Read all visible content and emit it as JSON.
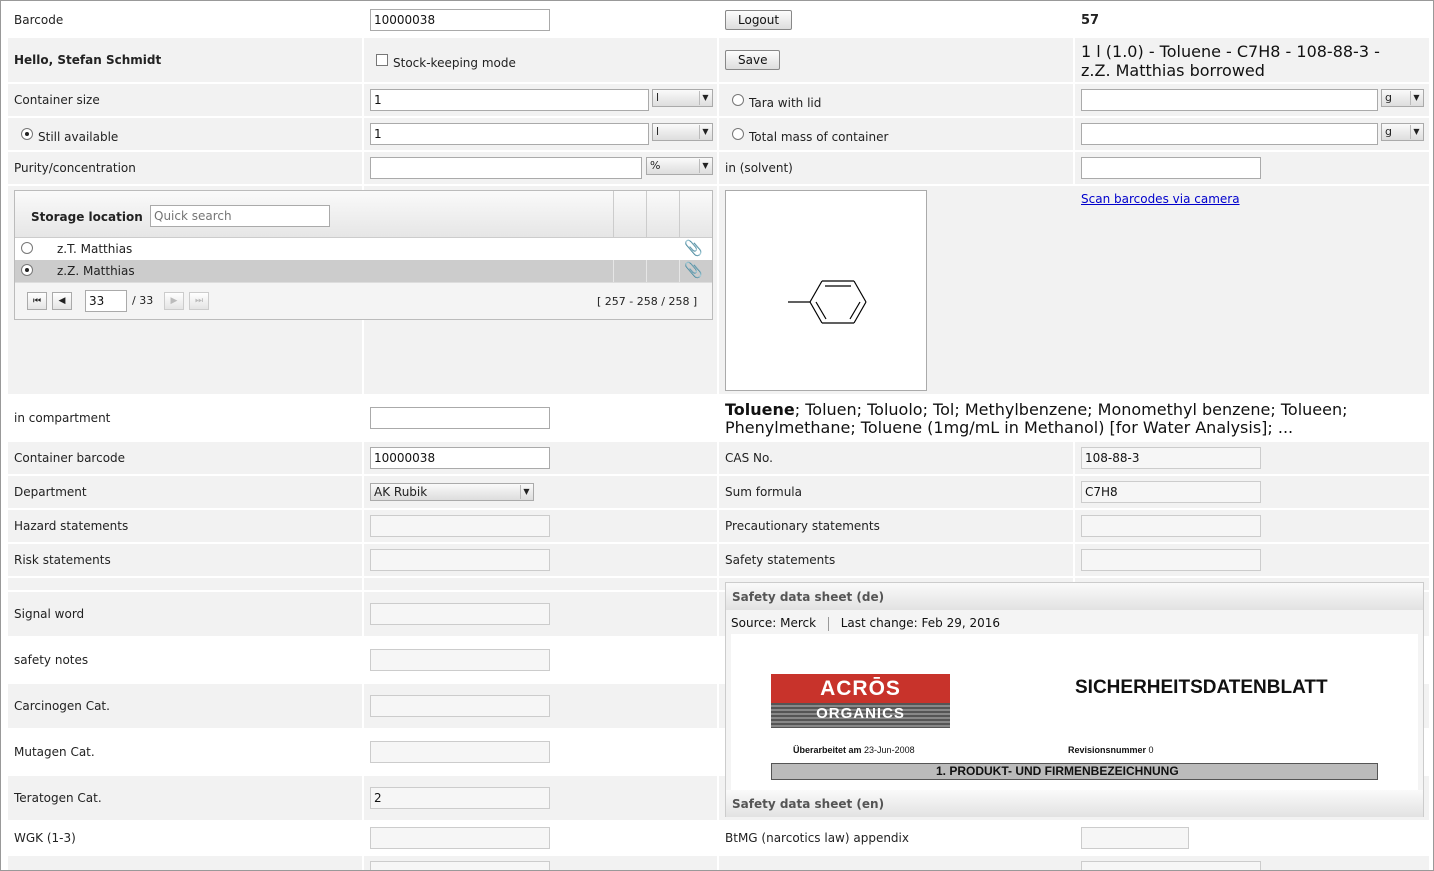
{
  "header": {
    "barcode_label": "Barcode",
    "barcode_value": "10000038",
    "logout_label": "Logout",
    "id_number": "57",
    "greeting": "Hello, Stefan Schmidt",
    "stock_mode_label": "Stock-keeping mode",
    "save_label": "Save",
    "summary_line1": "1 l (1.0) - Toluene - C7H8 - 108-88-3 -",
    "summary_line2": "z.Z. Matthias borrowed"
  },
  "amounts": {
    "container_size_label": "Container size",
    "container_size_value": "1",
    "container_size_unit": "l",
    "tara_label": "Tara with lid",
    "tara_value": "",
    "tara_unit": "g",
    "still_available_label": "Still available",
    "still_available_value": "1",
    "still_available_unit": "l",
    "total_mass_label": "Total mass of container",
    "total_mass_value": "",
    "total_mass_unit": "g",
    "purity_label": "Purity/concentration",
    "purity_value": "",
    "purity_unit": "%",
    "solvent_label": "in (solvent)",
    "solvent_value": ""
  },
  "storage": {
    "title": "Storage location",
    "search_placeholder": "Quick search",
    "rows": [
      {
        "name": "z.T. Matthias",
        "selected": false
      },
      {
        "name": "z.Z. Matthias",
        "selected": true
      }
    ],
    "page_value": "33",
    "page_total": "/ 33",
    "range": "[ 257 - 258 / 258 ]"
  },
  "scan_link": "Scan barcodes via camera",
  "compound": {
    "name_bold": "Toluene",
    "synonyms_line1": "; Toluen; Toluolo; Tol; Methylbenzene; Monomethyl benzene; Tolueen;",
    "synonyms_line2": "Phenylmethane; Toluene (1mg/mL in Methanol) [for Water Analysis]; ..."
  },
  "fields": {
    "compartment_label": "in compartment",
    "compartment_value": "",
    "container_barcode_label": "Container barcode",
    "container_barcode_value": "10000038",
    "cas_label": "CAS No.",
    "cas_value": "108-88-3",
    "department_label": "Department",
    "department_value": "AK Rubik",
    "sum_formula_label": "Sum formula",
    "sum_formula_value": "C7H8",
    "hazard_label": "Hazard statements",
    "precautionary_label": "Precautionary statements",
    "risk_label": "Risk statements",
    "safety_statements_label": "Safety statements",
    "signal_label": "Signal word",
    "safety_notes_label": "safety notes",
    "carcinogen_label": "Carcinogen Cat.",
    "mutagen_label": "Mutagen Cat.",
    "teratogen_label": "Teratogen Cat.",
    "teratogen_value": "2",
    "wgk_label": "WGK (1-3)",
    "btmg_label": "BtMG (narcotics law) appendix"
  },
  "sds": {
    "de_title": "Safety data sheet (de)",
    "source_label": "Source:",
    "source_value": "Merck",
    "last_change_label": "Last change:",
    "last_change_value": "Feb 29, 2016",
    "logo_top": "ACRŌS",
    "logo_bottom": "ORGANICS",
    "doc_title": "SICHERHEITSDATENBLATT",
    "revised_label": "Überarbeitet am",
    "revised_value": "23-Jun-2008",
    "revision_label": "Revisionsnummer",
    "revision_value": "0",
    "section_heading": "1.  PRODUKT- UND FIRMENBEZEICHNUNG",
    "en_title": "Safety data sheet (en)"
  },
  "icons": {
    "attachment": "paperclip-icon",
    "first": "first-page-icon",
    "prev": "prev-page-icon",
    "next": "next-page-icon",
    "last": "last-page-icon",
    "dropdown": "chevron-down-icon"
  }
}
